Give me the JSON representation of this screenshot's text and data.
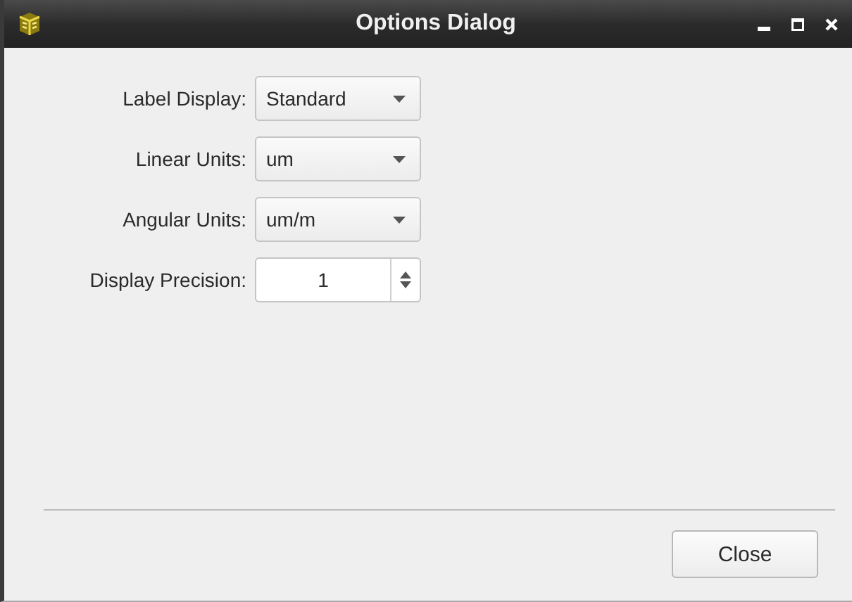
{
  "window": {
    "title": "Options Dialog"
  },
  "fields": [
    {
      "kind": "combo",
      "label": "Label Display:",
      "value": "Standard"
    },
    {
      "kind": "combo",
      "label": "Linear Units:",
      "value": "um"
    },
    {
      "kind": "combo",
      "label": "Angular Units:",
      "value": "um/m"
    },
    {
      "kind": "spin",
      "label": "Display Precision:",
      "value": "1"
    }
  ],
  "buttons": [
    "Close"
  ]
}
